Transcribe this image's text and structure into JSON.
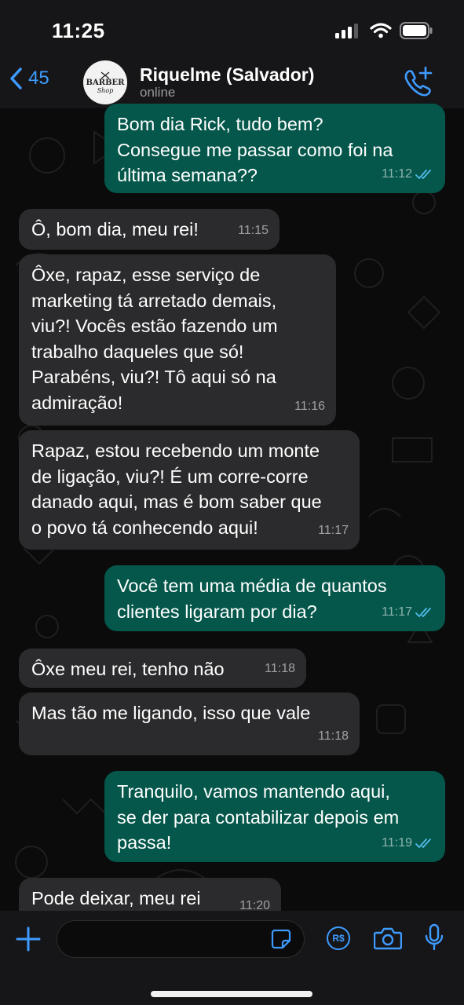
{
  "status_bar": {
    "time": "11:25"
  },
  "header": {
    "back_count": "45",
    "avatar_line1": "BARBER",
    "avatar_line2": "Shop",
    "contact_name": "Riquelme (Salvador)",
    "contact_status": "online"
  },
  "messages": [
    {
      "dir": "out",
      "text": "Bom dia Rick, tudo bem?\nConsegue me passar como foi na\núltima semana??",
      "time": "11:12",
      "read": true
    },
    {
      "dir": "in",
      "text": "Ô, bom dia, meu rei!",
      "time": "11:15"
    },
    {
      "dir": "in",
      "text": "Ôxe, rapaz, esse serviço de\nmarketing tá arretado demais,\nviu?! Vocês estão fazendo um\ntrabalho daqueles que só!\nParabéns, viu?! Tô aqui só na\nadmiração!",
      "time": "11:16"
    },
    {
      "dir": "in",
      "text": "Rapaz, estou recebendo um monte\nde ligação, viu?! É um corre-corre\ndanado aqui, mas é bom saber que\no povo tá conhecendo aqui!",
      "time": "11:17"
    },
    {
      "dir": "out",
      "text": "Você tem uma média de quantos\nclientes ligaram por dia?",
      "time": "11:17",
      "read": true
    },
    {
      "dir": "in",
      "text": "Ôxe meu rei, tenho não",
      "time": "11:18"
    },
    {
      "dir": "in",
      "text": "Mas tão me ligando, isso que vale",
      "time": "11:18"
    },
    {
      "dir": "out",
      "text": "Tranquilo, vamos mantendo aqui,\nse der para contabilizar depois em\npassa!",
      "time": "11:19",
      "read": true
    },
    {
      "dir": "in",
      "text": "Pode deixar, meu rei",
      "time": "11:20"
    }
  ],
  "colors": {
    "incoming_bubble": "#2b2b2d",
    "outgoing_bubble": "#04574a",
    "accent": "#3e9bff",
    "read_ticks": "#53bdeb"
  },
  "composer": {
    "icons": [
      "plus-icon",
      "sticker-icon",
      "pix-payment-icon",
      "camera-icon",
      "microphone-icon"
    ],
    "pix_label": "R$"
  }
}
